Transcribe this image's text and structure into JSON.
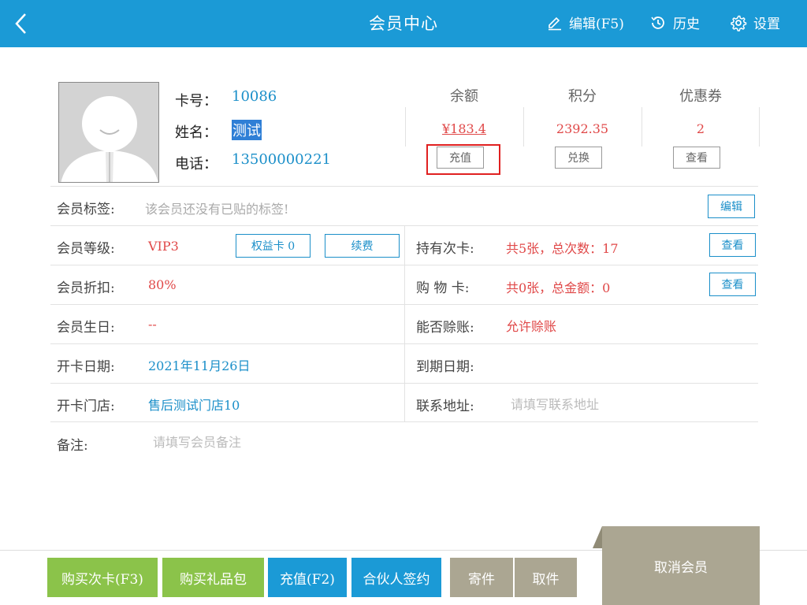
{
  "header": {
    "title": "会员中心",
    "edit_label": "编辑(F5)",
    "history_label": "历史",
    "settings_label": "设置"
  },
  "member": {
    "card_no_label": "卡号：",
    "card_no": "10086",
    "name_label": "姓名：",
    "name": "测试",
    "phone_label": "电话：",
    "phone": "13500000221"
  },
  "stats": {
    "balance_label": "余额",
    "balance_value": "¥183.4",
    "recharge_btn": "充值",
    "points_label": "积分",
    "points_value": "2392.35",
    "exchange_btn": "兑换",
    "coupons_label": "优惠券",
    "coupons_value": "2",
    "view_btn": "查看"
  },
  "tags": {
    "label": "会员标签:",
    "placeholder": "该会员还没有已贴的标签!",
    "edit_btn": "编辑"
  },
  "details": {
    "level_label": "会员等级:",
    "level_value": "VIP3",
    "rights_card_btn": "权益卡 0",
    "renew_btn": "续费",
    "times_card_label": "持有次卡:",
    "times_card_value": "共5张，总次数：17",
    "times_card_view_btn": "查看",
    "discount_label": "会员折扣:",
    "discount_value": "80%",
    "shopping_card_label": "购 物 卡:",
    "shopping_card_value": "共0张，总金额：0",
    "shopping_card_view_btn": "查看",
    "birthday_label": "会员生日:",
    "birthday_value": "--",
    "credit_label": "能否赊账:",
    "credit_value": "允许赊账",
    "open_date_label": "开卡日期:",
    "open_date_value": "2021年11月26日",
    "expire_label": "到期日期:",
    "expire_value": "",
    "store_label": "开卡门店:",
    "store_value": "售后测试门店10",
    "address_label": "联系地址:",
    "address_placeholder": "请填写联系地址",
    "remark_label": "备注:",
    "remark_placeholder": "请填写会员备注"
  },
  "footer": {
    "buy_times_card": "购买次卡(F3)",
    "buy_gift_pack": "购买礼品包",
    "recharge": "充值(F2)",
    "partner_sign": "合伙人签约",
    "deposit": "寄件",
    "pickup": "取件",
    "cancel_member": "取消会员"
  },
  "colors": {
    "accent": "#1b9ad6",
    "green": "#8bc34a",
    "khaki": "#aba692",
    "red": "#e04848"
  }
}
